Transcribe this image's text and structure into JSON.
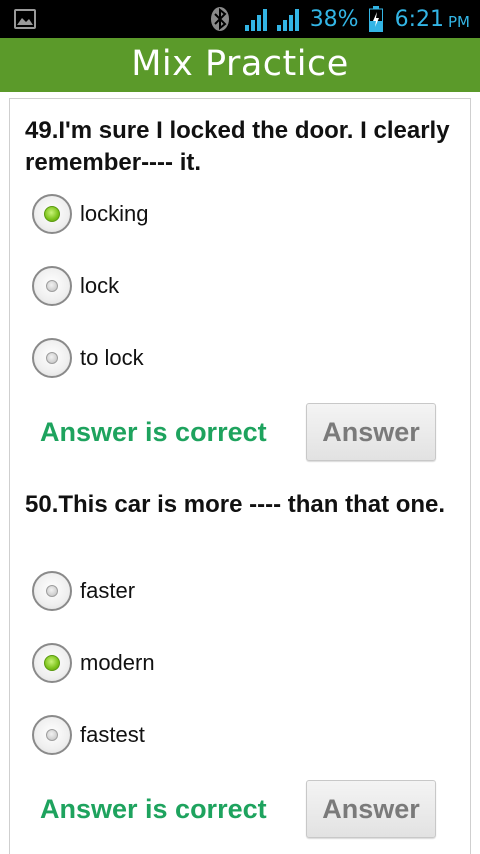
{
  "status_bar": {
    "battery_percent": "38%",
    "time": "6:21",
    "ampm": "PM",
    "icons": [
      "image-icon",
      "bluetooth-icon",
      "signal-icon",
      "signal-icon",
      "battery-charging-icon"
    ],
    "accent_color": "#33b5e5"
  },
  "app_bar": {
    "title": "Mix Practice",
    "color": "#5b9a2a"
  },
  "questions": [
    {
      "text": "49.I'm sure I locked the door. I clearly remember---- it.",
      "options": [
        {
          "label": "locking",
          "selected": true
        },
        {
          "label": "lock",
          "selected": false
        },
        {
          "label": "to lock",
          "selected": false
        }
      ],
      "feedback": "Answer is correct",
      "button_label": "Answer"
    },
    {
      "text": "50.This car is more ---- than that one.",
      "options": [
        {
          "label": "faster",
          "selected": false
        },
        {
          "label": "modern",
          "selected": true
        },
        {
          "label": "fastest",
          "selected": false
        }
      ],
      "feedback": "Answer is correct",
      "button_label": "Answer"
    }
  ],
  "colors": {
    "feedback_correct": "#1ea35e",
    "radio_selected": "#7cc21a"
  }
}
